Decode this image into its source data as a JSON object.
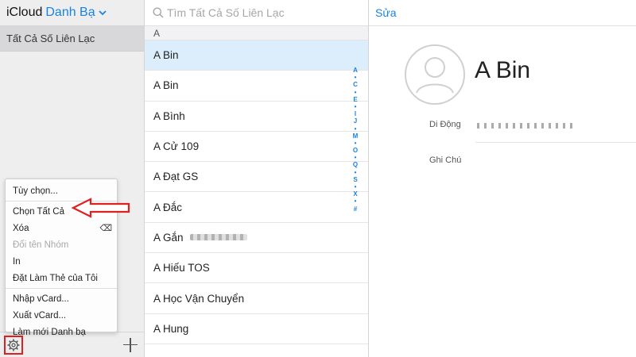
{
  "sidebar": {
    "app_name": "iCloud",
    "section_name": "Danh Bạ",
    "groups": [
      "Tất Cả Số Liên Lạc"
    ]
  },
  "menu": {
    "items": [
      {
        "label": "Tùy chọn..."
      },
      {
        "label": "Chọn Tất Cả"
      },
      {
        "label": "Xóa",
        "shortcut": "⌫"
      },
      {
        "label": "Đổi tên Nhóm"
      },
      {
        "label": "In"
      },
      {
        "label": "Đặt Làm Thẻ của Tôi"
      },
      {
        "label": "Nhập vCard..."
      },
      {
        "label": "Xuất vCard..."
      },
      {
        "label": "Làm mới Danh bạ"
      }
    ]
  },
  "list": {
    "search_placeholder": "Tìm Tất Cả Số Liên Lạc",
    "section": "A",
    "contacts": [
      "A Bin",
      "A Bin",
      "A Bình",
      "A Cử 109",
      "A Đạt GS",
      "A Đắc",
      "A Gắn",
      "A Hiếu TOS",
      "A Học Vận Chuyển",
      "A Hung"
    ],
    "index": [
      "A",
      "•",
      "C",
      "•",
      "E",
      "•",
      "I",
      "J",
      "•",
      "M",
      "•",
      "O",
      "•",
      "Q",
      "•",
      "S",
      "•",
      "X",
      "•",
      "#"
    ]
  },
  "detail": {
    "edit_label": "Sửa",
    "name": "A Bin",
    "mobile_label": "Di Động",
    "note_label": "Ghi Chú"
  },
  "colors": {
    "accent": "#1a82e2",
    "annotation": "#e02020",
    "selected_row": "#dceefb"
  }
}
